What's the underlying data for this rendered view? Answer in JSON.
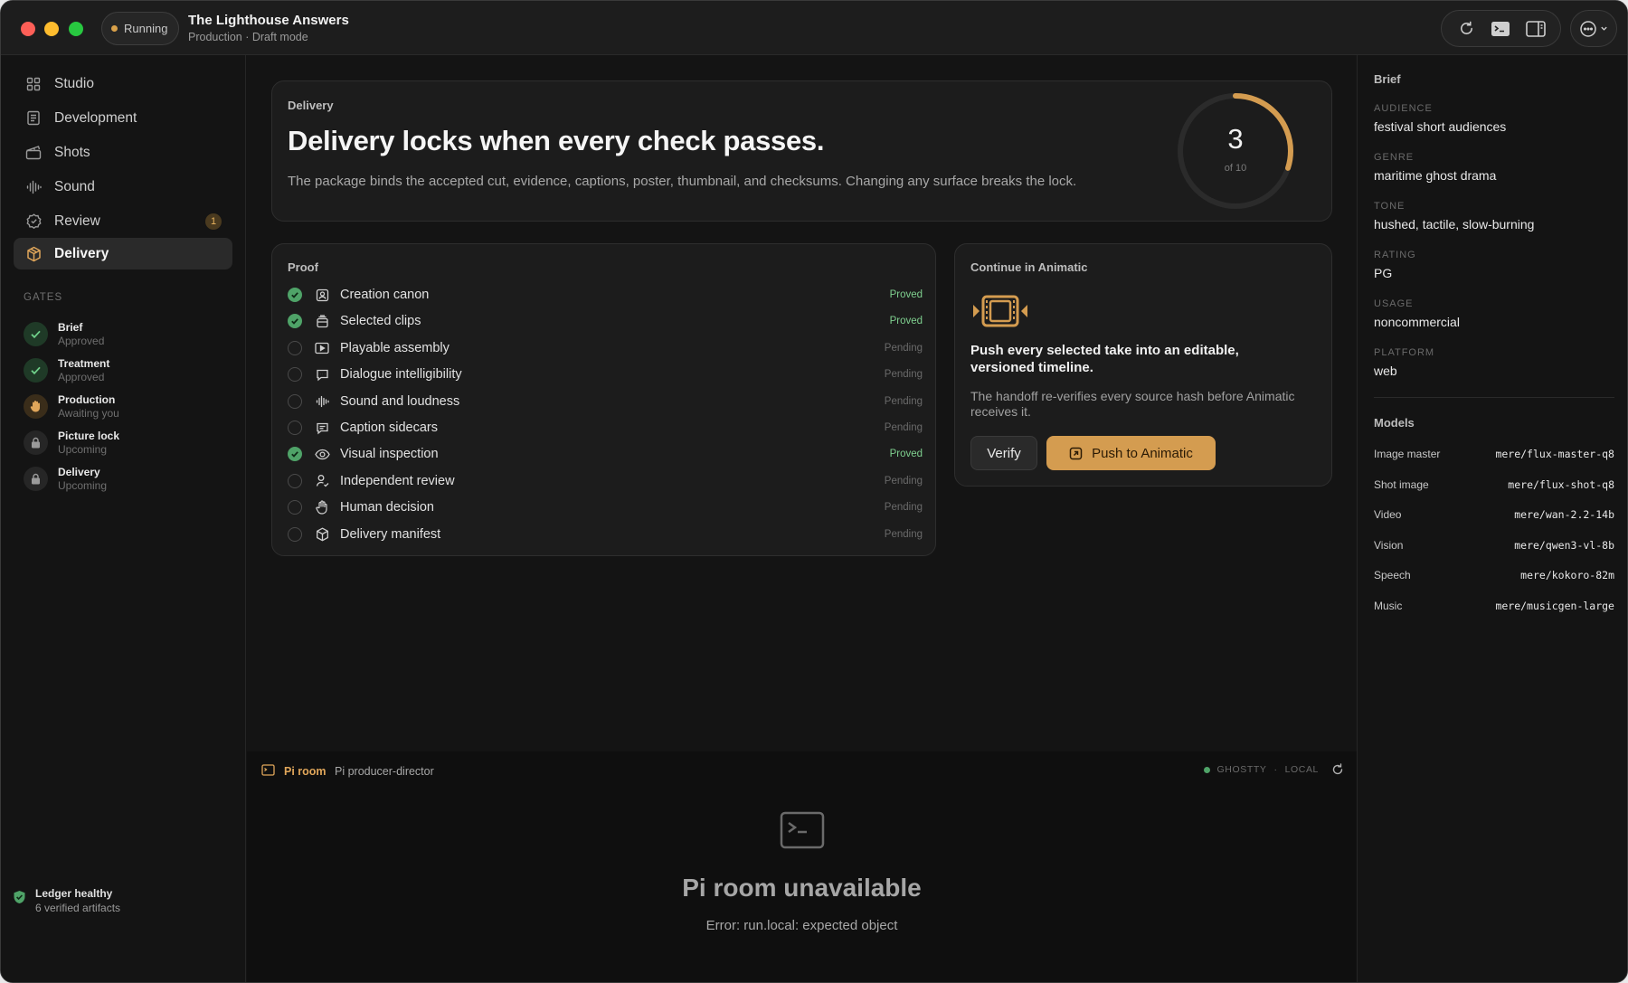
{
  "titlebar": {
    "status": "Running",
    "title": "The Lighthouse Answers",
    "subtitle": "Production · Draft mode"
  },
  "sidebar": {
    "items": [
      {
        "label": "Studio",
        "icon": "grid-icon"
      },
      {
        "label": "Development",
        "icon": "document-icon"
      },
      {
        "label": "Shots",
        "icon": "clapperboard-icon"
      },
      {
        "label": "Sound",
        "icon": "waveform-icon"
      },
      {
        "label": "Review",
        "icon": "badge-check-icon",
        "badge": "1"
      },
      {
        "label": "Delivery",
        "icon": "package-icon",
        "active": true
      }
    ],
    "gates_label": "GATES",
    "gates": [
      {
        "name": "Brief",
        "state": "Approved",
        "kind": "ok"
      },
      {
        "name": "Treatment",
        "state": "Approved",
        "kind": "ok"
      },
      {
        "name": "Production",
        "state": "Awaiting you",
        "kind": "wait"
      },
      {
        "name": "Picture lock",
        "state": "Upcoming",
        "kind": "lock"
      },
      {
        "name": "Delivery",
        "state": "Upcoming",
        "kind": "lock"
      }
    ],
    "ledger": {
      "title": "Ledger healthy",
      "sub": "6 verified artifacts"
    }
  },
  "hero": {
    "eyebrow": "Delivery",
    "title": "Delivery locks when every check passes.",
    "desc": "The package binds the accepted cut, evidence, captions, poster, thumbnail, and checksums. Changing any surface breaks the lock.",
    "progress_num": "3",
    "progress_of": "of 10",
    "progress_fraction": 0.3
  },
  "proof": {
    "label": "Proof",
    "rows": [
      {
        "label": "Creation canon",
        "status": "Proved",
        "done": true,
        "icon": "id-card-icon"
      },
      {
        "label": "Selected clips",
        "status": "Proved",
        "done": true,
        "icon": "film-stack-icon"
      },
      {
        "label": "Playable assembly",
        "status": "Pending",
        "done": false,
        "icon": "play-square-icon"
      },
      {
        "label": "Dialogue intelligibility",
        "status": "Pending",
        "done": false,
        "icon": "speech-bubble-icon"
      },
      {
        "label": "Sound and loudness",
        "status": "Pending",
        "done": false,
        "icon": "waveform-icon"
      },
      {
        "label": "Caption sidecars",
        "status": "Pending",
        "done": false,
        "icon": "caption-bubble-icon"
      },
      {
        "label": "Visual inspection",
        "status": "Proved",
        "done": true,
        "icon": "eye-icon"
      },
      {
        "label": "Independent review",
        "status": "Pending",
        "done": false,
        "icon": "user-check-icon"
      },
      {
        "label": "Human decision",
        "status": "Pending",
        "done": false,
        "icon": "hand-icon"
      },
      {
        "label": "Delivery manifest",
        "status": "Pending",
        "done": false,
        "icon": "package-icon"
      }
    ]
  },
  "animatic": {
    "label": "Continue in Animatic",
    "headline": "Push every selected take into an editable, versioned timeline.",
    "desc": "The handoff re-verifies every source hash before Animatic receives it.",
    "verify_label": "Verify",
    "push_label": "Push to Animatic",
    "accent": "#d49c50"
  },
  "piroom": {
    "name": "Pi room",
    "role": "Pi producer-director",
    "status_a": "GHOSTTY",
    "status_sep": "·",
    "status_b": "LOCAL",
    "empty_title": "Pi room unavailable",
    "error": "Error: run.local: expected object"
  },
  "brief": {
    "heading": "Brief",
    "fields": [
      {
        "key": "AUDIENCE",
        "value": "festival short audiences"
      },
      {
        "key": "GENRE",
        "value": "maritime ghost drama"
      },
      {
        "key": "TONE",
        "value": "hushed, tactile, slow-burning"
      },
      {
        "key": "RATING",
        "value": "PG"
      },
      {
        "key": "USAGE",
        "value": "noncommercial"
      },
      {
        "key": "PLATFORM",
        "value": "web"
      }
    ]
  },
  "models": {
    "heading": "Models",
    "rows": [
      {
        "key": "Image master",
        "value": "mere/flux-master-q8"
      },
      {
        "key": "Shot image",
        "value": "mere/flux-shot-q8"
      },
      {
        "key": "Video",
        "value": "mere/wan-2.2-14b"
      },
      {
        "key": "Vision",
        "value": "mere/qwen3-vl-8b"
      },
      {
        "key": "Speech",
        "value": "mere/kokoro-82m"
      },
      {
        "key": "Music",
        "value": "mere/musicgen-large"
      }
    ]
  }
}
